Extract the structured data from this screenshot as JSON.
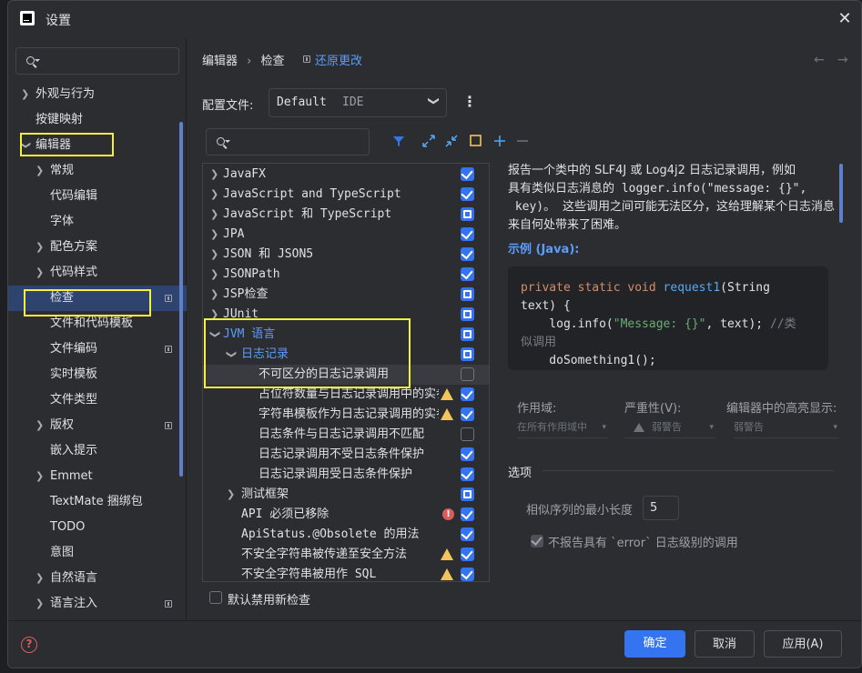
{
  "window": {
    "title": "设置",
    "close_icon": "close-icon"
  },
  "search": {
    "placeholder": ""
  },
  "sidebar": {
    "items": [
      {
        "label": "外观与行为",
        "expandable": true
      },
      {
        "label": "按键映射",
        "expandable": false
      },
      {
        "label": "编辑器",
        "expandable": true,
        "expanded": true
      },
      {
        "label": "常规",
        "expandable": true
      },
      {
        "label": "代码编辑",
        "expandable": false
      },
      {
        "label": "字体",
        "expandable": false
      },
      {
        "label": "配色方案",
        "expandable": true
      },
      {
        "label": "代码样式",
        "expandable": true
      },
      {
        "label": "检查",
        "selected": true,
        "badge": true
      },
      {
        "label": "文件和代码模板"
      },
      {
        "label": "文件编码",
        "badge": true
      },
      {
        "label": "实时模板"
      },
      {
        "label": "文件类型"
      },
      {
        "label": "版权",
        "expandable": true,
        "badge": true
      },
      {
        "label": "嵌入提示"
      },
      {
        "label": "Emmet",
        "expandable": true
      },
      {
        "label": "TextMate 捆绑包"
      },
      {
        "label": "TODO"
      },
      {
        "label": "意图"
      },
      {
        "label": "自然语言",
        "expandable": true
      },
      {
        "label": "语言注入",
        "expandable": true,
        "badge": true
      }
    ]
  },
  "header": {
    "crumb1": "编辑器",
    "sep": "›",
    "crumb2": "检查",
    "revert": "还原更改"
  },
  "profile": {
    "label": "配置文件:",
    "name": "Default",
    "scope": "IDE"
  },
  "inspections": [
    {
      "label": "JavaFX",
      "state": "on"
    },
    {
      "label": "JavaScript and TypeScript",
      "state": "on"
    },
    {
      "label": "JavaScript 和 TypeScript",
      "state": "part"
    },
    {
      "label": "JPA",
      "state": "on"
    },
    {
      "label": "JSON 和 JSON5",
      "state": "on"
    },
    {
      "label": "JSONPath",
      "state": "on"
    },
    {
      "label": "JSP检查",
      "state": "part"
    },
    {
      "label": "JUnit",
      "state": "part"
    },
    {
      "label": "JVM 语言",
      "state": "part"
    },
    {
      "label": "日志记录",
      "state": "part"
    },
    {
      "label": "不可区分的日志记录调用",
      "state": "off"
    },
    {
      "label": "占位符数量与日志记录调用中的实参",
      "state": "on",
      "severity": "warn"
    },
    {
      "label": "字符串模板作为日志记录调用的实参",
      "state": "on",
      "severity": "warn"
    },
    {
      "label": "日志条件与日志记录调用不匹配",
      "state": "off"
    },
    {
      "label": "日志记录调用不受日志条件保护",
      "state": "on"
    },
    {
      "label": "日志记录调用受日志条件保护",
      "state": "on"
    },
    {
      "label": "测试框架",
      "state": "part"
    },
    {
      "label": "API 必须已移除",
      "state": "on",
      "severity": "error"
    },
    {
      "label": "ApiStatus.@Obsolete 的用法",
      "state": "on"
    },
    {
      "label": "不安全字符串被传递至安全方法",
      "state": "on",
      "severity": "warn"
    },
    {
      "label": "不安全字符串被用作 SQL",
      "state": "on",
      "severity": "warn"
    }
  ],
  "default_disable": "默认禁用新检查",
  "description": {
    "line1": "报告一个类中的 SLF4J 或 Log4j2 日志记录调用，例如",
    "line2": "具有类似日志消息的 logger.info(\"message: {}\",",
    "line3": " key)。 这些调用之间可能无法区分，这给理解某个日志消息",
    "line4": "来自何处带来了困难。",
    "example_title": "示例 (Java):"
  },
  "code": {
    "l1_kw": "private static void",
    "l1_fn": " request1",
    "l1_rest": "(String",
    "l2": "text) {",
    "l3_a": "    log.info(",
    "l3_str": "\"Message: {}\"",
    "l3_b": ", text); ",
    "l3_cm": "//类",
    "l4_cm": "似调用",
    "l5": "    doSomething1();"
  },
  "fields": {
    "scope_label": "作用域:",
    "scope_value": "在所有作用域中",
    "severity_label": "严重性(V):",
    "severity_value": "弱警告",
    "highlight_label": "编辑器中的高亮显示:",
    "highlight_value": "弱警告"
  },
  "options": {
    "title": "选项",
    "min_len_label": "相似序列的最小长度",
    "min_len_value": "5",
    "no_error_label": "不报告具有 `error` 日志级别的调用"
  },
  "footer": {
    "ok": "确定",
    "cancel": "取消",
    "apply": "应用(A)"
  },
  "colors": {
    "accent": "#3574f0",
    "highlight": "#f5f03b",
    "link": "#5c9cfa"
  }
}
